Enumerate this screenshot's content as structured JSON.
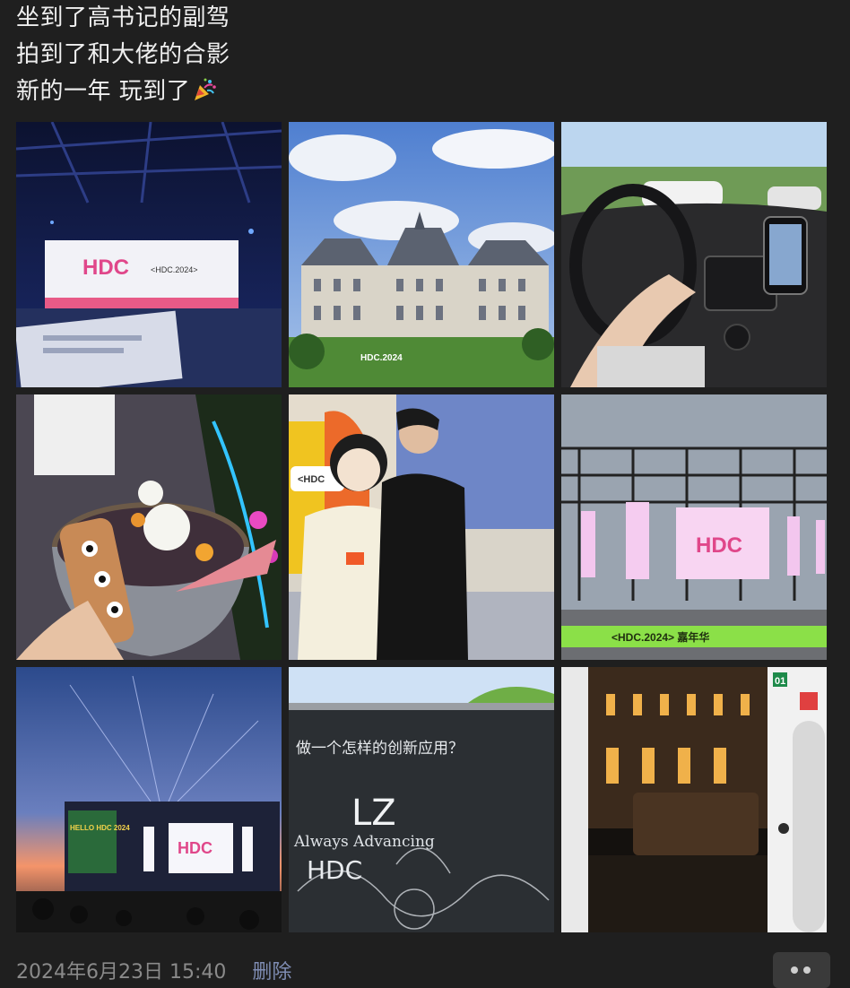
{
  "post": {
    "lines": [
      "坐到了高书记的副驾",
      "拍到了和大佬的合影",
      "新的一年 玩到了"
    ],
    "trailing_icon": "party-popper-icon"
  },
  "photos": [
    {
      "name": "photo-hdc-stage-night",
      "screen_text": "HDC",
      "screen_sub": "<HDC.2024>"
    },
    {
      "name": "photo-chateau",
      "sign_text": "HDC.2024"
    },
    {
      "name": "photo-car-driving"
    },
    {
      "name": "photo-dessert-cup"
    },
    {
      "name": "photo-group-selfie",
      "sign_text": "<HDC"
    },
    {
      "name": "photo-outdoor-stage",
      "screen_text": "HDC",
      "banner_text": "<HDC.2024> 嘉年华"
    },
    {
      "name": "photo-sunset-stage",
      "screen_text": "HDC",
      "side_text": "HELLO HDC 2024"
    },
    {
      "name": "photo-chalkboard",
      "chalk_text": [
        "做一个怎样的创新应用？",
        "LZ",
        "Always Advancing",
        "HDC"
      ]
    },
    {
      "name": "photo-night-building",
      "door_number": "01"
    }
  ],
  "footer": {
    "timestamp": "2024年6月23日 15:40",
    "delete_label": "删除",
    "more_icon": "more-dots-icon"
  },
  "colors": {
    "background": "#1f1f1f",
    "text": "#efefef",
    "meta": "#8a8a8a",
    "link": "#7f8db3"
  }
}
